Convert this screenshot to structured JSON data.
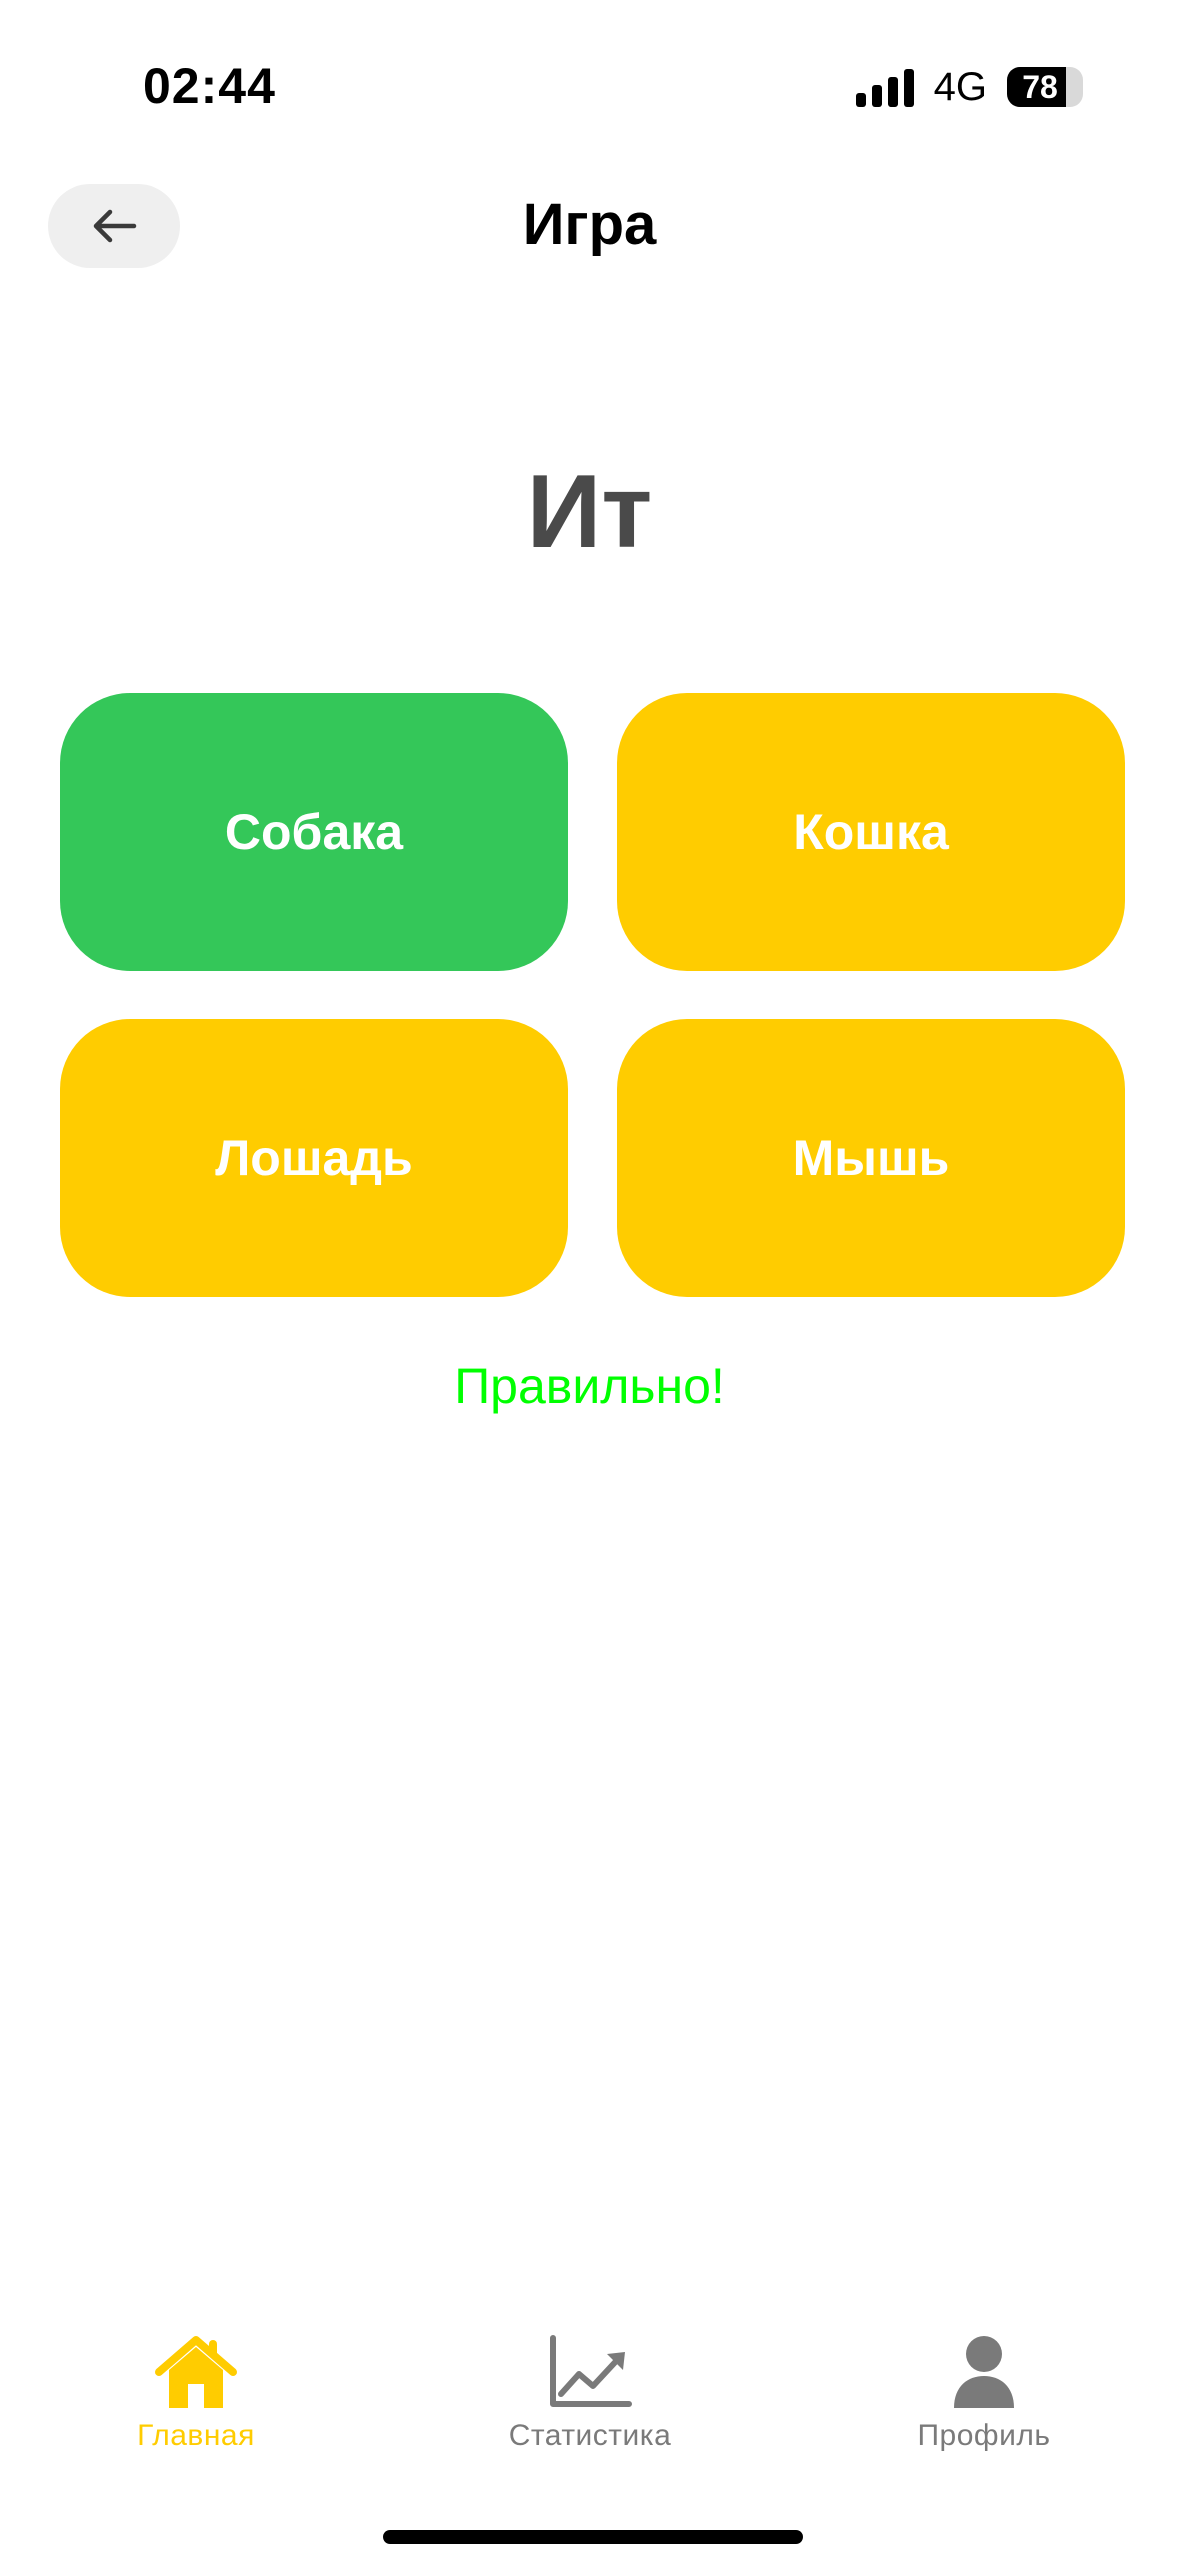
{
  "status_bar": {
    "time": "02:44",
    "network": "4G",
    "battery_level": "78"
  },
  "header": {
    "title": "Игра",
    "back_icon": "arrow-left-icon"
  },
  "game": {
    "word": "Ит",
    "answers": [
      {
        "label": "Собака",
        "state": "correct"
      },
      {
        "label": "Кошка",
        "state": "default"
      },
      {
        "label": "Лошадь",
        "state": "default"
      },
      {
        "label": "Мышь",
        "state": "default"
      }
    ],
    "feedback": "Правильно!"
  },
  "tab_bar": {
    "items": [
      {
        "label": "Главная",
        "icon": "home-icon",
        "active": true
      },
      {
        "label": "Статистика",
        "icon": "chart-icon",
        "active": false
      },
      {
        "label": "Профиль",
        "icon": "person-icon",
        "active": false
      }
    ]
  },
  "colors": {
    "correct": "#34c759",
    "answer_default": "#ffcc00",
    "feedback": "#00ff00",
    "tab_active": "#ffcc00",
    "tab_inactive": "#7a7a7a",
    "word": "#4a4a4a",
    "back_button_bg": "#efefef"
  }
}
